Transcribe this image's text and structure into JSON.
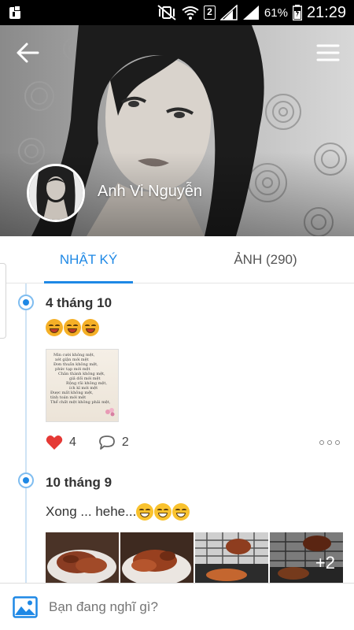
{
  "status_bar": {
    "sim": "2",
    "battery": "61%",
    "time": "21:29"
  },
  "profile": {
    "name": "Anh Vi Nguyễn"
  },
  "tabs": [
    {
      "label": "NHẬT KÝ",
      "active": true
    },
    {
      "label": "ẢNH (290)",
      "active": false
    }
  ],
  "posts": [
    {
      "date": "4 tháng 10",
      "emoji_text": [
        "blush-emoji",
        "blush-emoji",
        "blush-emoji"
      ],
      "image_text": [
        "Mìn cười không mệt,",
        "xét giận mới mệt",
        "Đơn thuần không mệt,",
        "phức tạp mới mệt",
        "Chân thành không mệt,",
        "giả dối mới mệt",
        "Rộng rãi không mệt,",
        "ích kỉ mới mệt",
        "Được mất không mệt,",
        "tính toán mới mệt",
        "Thể chất mệt không phải mệt,"
      ],
      "likes": "4",
      "comments": "2"
    },
    {
      "date": "10 tháng 9",
      "text": "Xong ... hehe...",
      "photo_more": "+2"
    }
  ],
  "composer": {
    "placeholder": "Bạn đang nghĩ gì?"
  },
  "colors": {
    "accent": "#1e88e5",
    "like": "#e53935"
  }
}
